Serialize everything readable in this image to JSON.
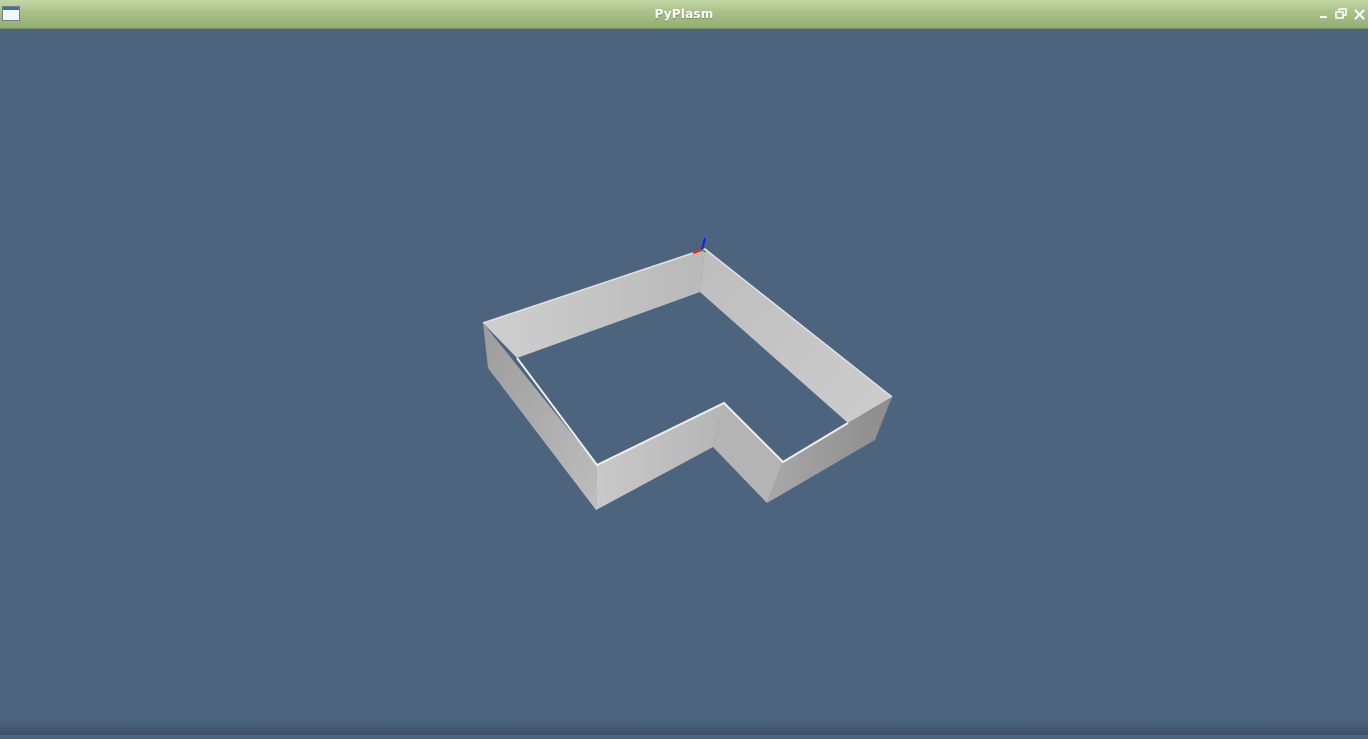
{
  "window": {
    "title": "PyPlasm",
    "background_color": "#4c647e",
    "titlebar_color": "#a7c087"
  },
  "titlebar": {
    "app_icon": "window-icon",
    "buttons": [
      {
        "name": "minimize",
        "icon": "minimize-icon"
      },
      {
        "name": "restore",
        "icon": "restore-icon"
      },
      {
        "name": "close",
        "icon": "close-icon"
      }
    ]
  },
  "scene": {
    "object": "extruded-l-shaped-wall",
    "wall_color": "#c8c8c8",
    "axes": {
      "x_color": "#ff0000",
      "y_color": "#00c000",
      "z_color": "#0000ff"
    }
  }
}
